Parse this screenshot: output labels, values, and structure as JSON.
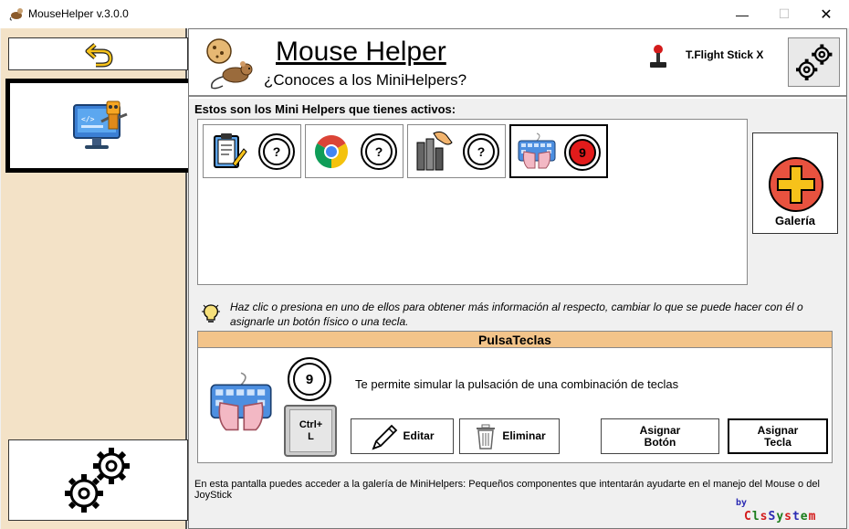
{
  "window": {
    "title": "MouseHelper v.3.0.0",
    "minimize": "—",
    "maximize": "☐",
    "close": "✕"
  },
  "header": {
    "title": "Mouse Helper",
    "subtitle": "¿Conoces a los MiniHelpers?",
    "joystick": "T.Flight Stick X"
  },
  "helpers": {
    "label": "Estos son los Mini Helpers que tienes activos:",
    "items": [
      {
        "icon": "clipboard-icon",
        "badge": "?"
      },
      {
        "icon": "chrome-icon",
        "badge": "?"
      },
      {
        "icon": "books-hand-icon",
        "badge": "?"
      },
      {
        "icon": "keyboard-hands-icon",
        "badge": "9",
        "selected": true
      }
    ]
  },
  "gallery": {
    "label": "Galería"
  },
  "hint": "Haz clic o presiona en uno de ellos para obtener más información al respecto, cambiar lo que se puede hacer con él o asignarle un botón físico o una tecla.",
  "detail": {
    "title": "PulsaTeclas",
    "number": "9",
    "key": "Ctrl+\nL",
    "description": "Te permite simular la pulsación de una combinación de teclas",
    "edit": "Editar",
    "delete": "Eliminar",
    "assign_button": "Asignar\nBotón",
    "assign_key": "Asignar\nTecla"
  },
  "footer": "En esta pantalla puedes acceder a la galería de MiniHelpers: Pequeños componentes que intentarán ayudarte en el manejo del Mouse o del JoyStick",
  "brand": {
    "by": "by",
    "name": "ClsSystem"
  },
  "colors": {
    "left_panel": "#f3e2c7",
    "detail_header": "#f3c48a",
    "accent_red": "#e21b1b"
  }
}
